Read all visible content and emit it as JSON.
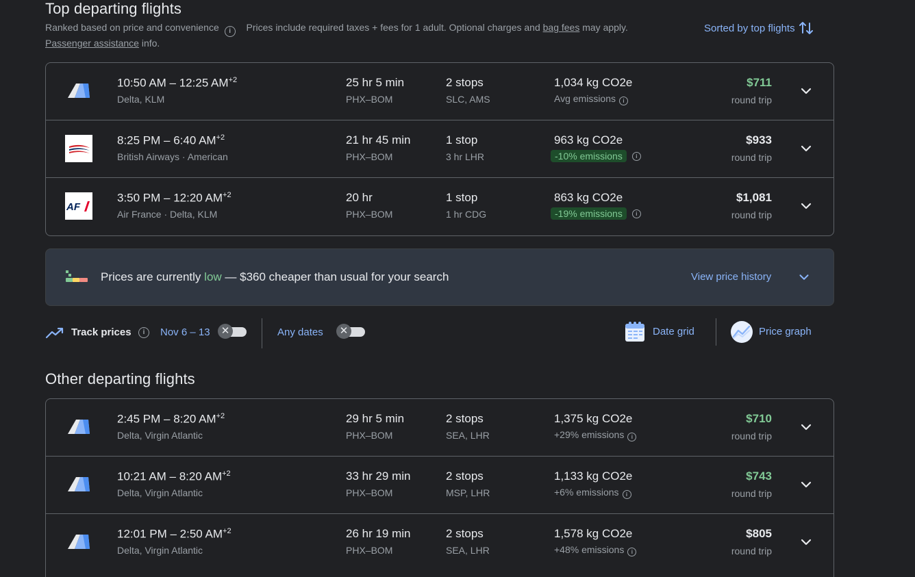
{
  "top": {
    "title": "Top departing flights",
    "subtitle_ranked": "Ranked based on price and convenience",
    "subtitle_taxes": "Prices include required taxes + fees for 1 adult. Optional charges and",
    "bag_fees_link": "bag fees",
    "subtitle_tail": "may apply.",
    "passenger_link": "Passenger assistance",
    "passenger_tail": "info.",
    "sort_label": "Sorted by top flights"
  },
  "top_flights": [
    {
      "logo": "delta",
      "times": "10:50 AM – 12:25 AM",
      "day_offset": "+2",
      "airline": "Delta, KLM",
      "duration": "25 hr 5 min",
      "route": "PHX–BOM",
      "stops": "2 stops",
      "stop_info": "SLC, AMS",
      "co2": "1,034 kg CO2e",
      "emissions": "Avg emissions",
      "emissions_badge": "",
      "price": "$711",
      "price_low": true,
      "trip": "round trip"
    },
    {
      "logo": "british-airways",
      "times": "8:25 PM – 6:40 AM",
      "day_offset": "+2",
      "airline": "British Airways · American",
      "duration": "21 hr 45 min",
      "route": "PHX–BOM",
      "stops": "1 stop",
      "stop_info": "3 hr LHR",
      "co2": "963 kg CO2e",
      "emissions": "",
      "emissions_badge": "-10% emissions",
      "price": "$933",
      "price_low": false,
      "trip": "round trip"
    },
    {
      "logo": "air-france",
      "times": "3:50 PM – 12:20 AM",
      "day_offset": "+2",
      "airline": "Air France · Delta, KLM",
      "duration": "20 hr",
      "route": "PHX–BOM",
      "stops": "1 stop",
      "stop_info": "1 hr CDG",
      "co2": "863 kg CO2e",
      "emissions": "",
      "emissions_badge": "-19% emissions",
      "price": "$1,081",
      "price_low": false,
      "trip": "round trip"
    }
  ],
  "insight": {
    "prefix": "Prices are currently",
    "level": "low",
    "suffix": "— $360 cheaper than usual for your search",
    "link": "View price history"
  },
  "tools": {
    "track_label": "Track prices",
    "dates": "Nov 6 – 13",
    "any_dates": "Any dates",
    "date_grid": "Date grid",
    "price_graph": "Price graph",
    "toggle_dates_on": false,
    "toggle_any_on": false
  },
  "other": {
    "title": "Other departing flights"
  },
  "other_flights": [
    {
      "logo": "delta",
      "times": "2:45 PM – 8:20 AM",
      "day_offset": "+2",
      "airline": "Delta, Virgin Atlantic",
      "duration": "29 hr 5 min",
      "route": "PHX–BOM",
      "stops": "2 stops",
      "stop_info": "SEA, LHR",
      "co2": "1,375 kg CO2e",
      "emissions": "+29% emissions",
      "emissions_badge": "",
      "price": "$710",
      "price_low": true,
      "trip": "round trip"
    },
    {
      "logo": "delta",
      "times": "10:21 AM – 8:20 AM",
      "day_offset": "+2",
      "airline": "Delta, Virgin Atlantic",
      "duration": "33 hr 29 min",
      "route": "PHX–BOM",
      "stops": "2 stops",
      "stop_info": "MSP, LHR",
      "co2": "1,133 kg CO2e",
      "emissions": "+6% emissions",
      "emissions_badge": "",
      "price": "$743",
      "price_low": true,
      "trip": "round trip"
    },
    {
      "logo": "delta",
      "times": "12:01 PM – 2:50 AM",
      "day_offset": "+2",
      "airline": "Delta, Virgin Atlantic",
      "duration": "26 hr 19 min",
      "route": "PHX–BOM",
      "stops": "2 stops",
      "stop_info": "SEA, LHR",
      "co2": "1,578 kg CO2e",
      "emissions": "+48% emissions",
      "emissions_badge": "",
      "price": "$805",
      "price_low": false,
      "trip": "round trip"
    }
  ],
  "colors": {
    "background": "#202124",
    "accent": "#8ab4f8",
    "low_price": "#81c995",
    "border": "#5f6368",
    "insight_bg": "#303742"
  }
}
